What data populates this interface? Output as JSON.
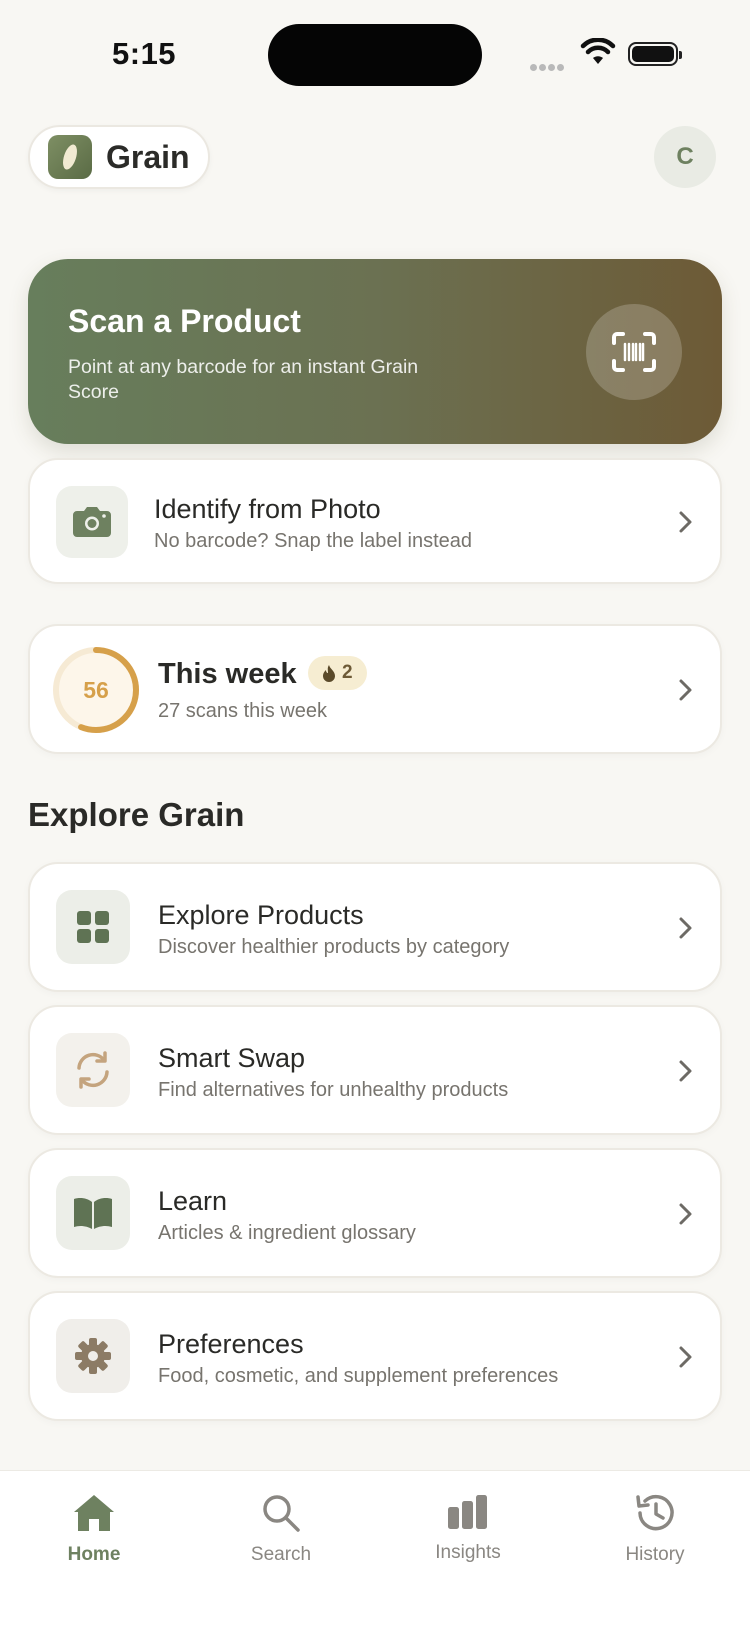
{
  "status_bar": {
    "time": "5:15"
  },
  "header": {
    "app_name": "Grain",
    "avatar_initial": "C"
  },
  "scan_card": {
    "title": "Scan a Product",
    "subtitle": "Point at any barcode for an instant Grain Score"
  },
  "photo_card": {
    "title": "Identify from Photo",
    "subtitle": "No barcode? Snap the label instead"
  },
  "week_card": {
    "score": "56",
    "score_fraction": 0.56,
    "title": "This week",
    "streak": "2",
    "subtitle": "27 scans this week"
  },
  "explore": {
    "section_title": "Explore Grain",
    "items": [
      {
        "title": "Explore Products",
        "subtitle": "Discover healthier products by category",
        "icon": "grid-icon"
      },
      {
        "title": "Smart Swap",
        "subtitle": "Find alternatives for unhealthy products",
        "icon": "swap-icon"
      },
      {
        "title": "Learn",
        "subtitle": "Articles & ingredient glossary",
        "icon": "book-icon"
      },
      {
        "title": "Preferences",
        "subtitle": "Food, cosmetic, and supplement preferences",
        "icon": "gear-icon"
      }
    ]
  },
  "tab_bar": {
    "tabs": [
      {
        "label": "Home",
        "icon": "home-icon",
        "active": true
      },
      {
        "label": "Search",
        "icon": "search-icon",
        "active": false
      },
      {
        "label": "Insights",
        "icon": "bar-chart-icon",
        "active": false
      },
      {
        "label": "History",
        "icon": "history-icon",
        "active": false
      }
    ]
  },
  "colors": {
    "accent": "#6e8160",
    "scan_gradient_start": "#677e5c",
    "scan_gradient_end": "#6d5a36",
    "score_ring": "#d6a04a",
    "background": "#f8f7f3"
  }
}
